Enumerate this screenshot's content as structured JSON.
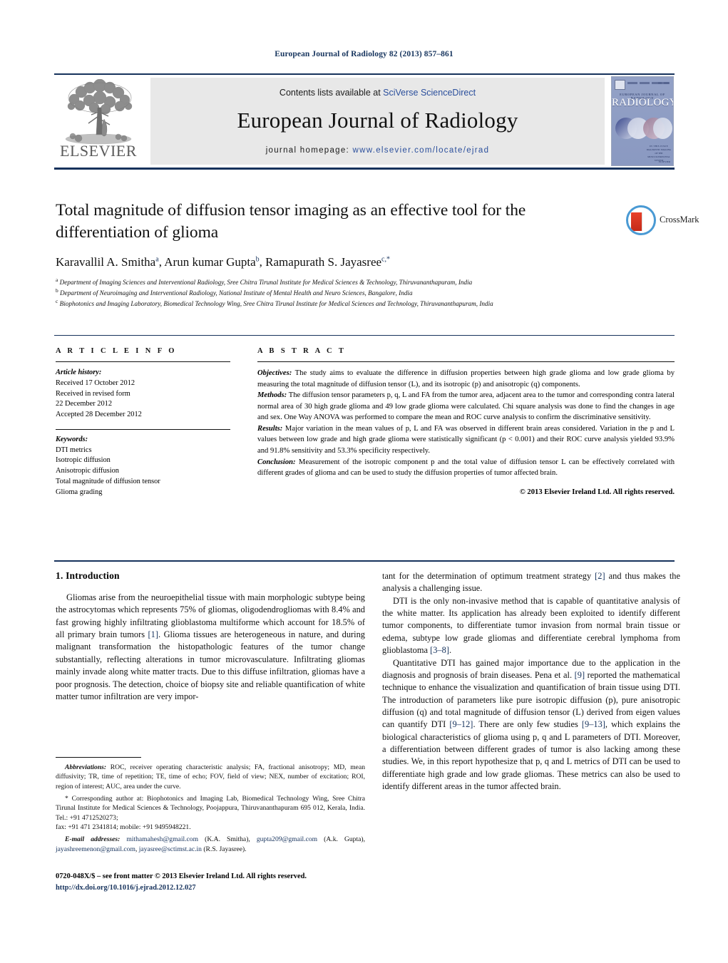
{
  "running_head": "European Journal of Radiology 82 (2013) 857–861",
  "masthead": {
    "publisher_name": "ELSEVIER",
    "contents_prefix": "Contents lists available at ",
    "contents_link": "SciVerse ScienceDirect",
    "journal_title": "European Journal of Radiology",
    "homepage_prefix": "journal homepage: ",
    "homepage_url": "www.elsevier.com/locate/ejrad"
  },
  "cover": {
    "journal_small": "EUROPEAN JOURNAL OF RADIOLOGY",
    "journal_big": "RADIOLOGY",
    "issue_heading": "IN THIS ISSUE",
    "issue_body": "DIAGNOSTIC IMAGING OF THE MUSCULOSKELETAL SYSTEM",
    "bottom_mark": "ELSEVIER"
  },
  "crossmark": {
    "label": "CrossMark"
  },
  "article": {
    "title": "Total magnitude of diffusion tensor imaging as an effective tool for the differentiation of glioma",
    "authors_html": "Karavallil A. Smitha<sup>a</sup>, Arun kumar Gupta<sup>b</sup>, Ramapurath S. Jayasree<sup>c,*</sup>",
    "affiliations": [
      "Department of Imaging Sciences and Interventional Radiology, Sree Chitra Tirunal Institute for Medical Sciences & Technology, Thiruvananthapuram, India",
      "Department of Neuroimaging and Interventional Radiology, National Institute of Mental Health and Neuro Sciences, Bangalore, India",
      "Biophotonics and Imaging Laboratory, Biomedical Technology Wing, Sree Chitra Tirunal Institute for Medical Sciences and Technology, Thiruvananthapuram, India"
    ]
  },
  "article_info": {
    "label": "A R T I C L E  I N F O",
    "history_label": "Article history:",
    "history_lines": [
      "Received 17 October 2012",
      "Received in revised form",
      "22 December 2012",
      "Accepted 28 December 2012"
    ],
    "keywords_label": "Keywords:",
    "keywords": [
      "DTI metrics",
      "Isotropic diffusion",
      "Anisotropic diffusion",
      "Total magnitude of diffusion tensor",
      "Glioma grading"
    ]
  },
  "abstract": {
    "label": "A B S T R A C T",
    "objectives_label": "Objectives:",
    "objectives_text": " The study aims to evaluate the difference in diffusion properties between high grade glioma and low grade glioma by measuring the total magnitude of diffusion tensor (L), and its isotropic (p) and anisotropic (q) components.",
    "methods_label": "Methods:",
    "methods_text": " The diffusion tensor parameters p, q, L and FA from the tumor area, adjacent area to the tumor and corresponding contra lateral normal area of 30 high grade glioma and 49 low grade glioma were calculated. Chi square analysis was done to find the changes in age and sex. One Way ANOVA was performed to compare the mean and ROC curve analysis to confirm the discriminative sensitivity.",
    "results_label": "Results:",
    "results_text": " Major variation in the mean values of p, L and FA was observed in different brain areas considered. Variation in the p and L values between low grade and high grade glioma were statistically significant (p < 0.001) and their ROC curve analysis yielded 93.9% and 91.8% sensitivity and 53.3% specificity respectively.",
    "conclusion_label": "Conclusion:",
    "conclusion_text": " Measurement of the isotropic component p and the total value of diffusion tensor L can be effectively correlated with different grades of glioma and can be used to study the diffusion properties of tumor affected brain.",
    "copyright": "© 2013 Elsevier Ireland Ltd. All rights reserved."
  },
  "introduction": {
    "heading": "1.  Introduction",
    "para1_a": "Gliomas arise from the neuroepithelial tissue with main morphologic subtype being the astrocytomas which represents 75% of gliomas, oligodendrogliomas with 8.4% and fast growing highly infiltrating glioblastoma multiforme which account for 18.5% of all primary brain tumors ",
    "para1_ref": "[1]",
    "para1_b": ". Glioma tissues are heterogeneous in nature, and during malignant transformation the histopathologic features of the tumor change substantially, reflecting alterations in tumor microvasculature. Infiltrating gliomas mainly invade along white matter tracts. Due to this diffuse infiltration, gliomas have a poor prognosis. The detection, choice of biopsy site and reliable quantification of white matter tumor infiltration are very important for the determination of optimum treatment strategy ",
    "para1_ref2": "[2]",
    "para1_c": " and thus makes the analysis a challenging issue.",
    "para2_a": "DTI is the only non-invasive method that is capable of quantitative analysis of the white matter. Its application has already been exploited to identify different tumor components, to differentiate tumor invasion from normal brain tissue or edema, subtype low grade gliomas and differentiate cerebral lymphoma from glioblastoma ",
    "para2_ref": "[3–8]",
    "para2_b": ".",
    "para3_a": "Quantitative DTI has gained major importance due to the application in the diagnosis and prognosis of brain diseases. Pena et al. ",
    "para3_ref": "[9]",
    "para3_b": " reported the mathematical technique to enhance the visualization and quantification of brain tissue using DTI. The introduction of parameters like pure isotropic diffusion (p), pure anisotropic diffusion (q) and total magnitude of diffusion tensor (L) derived from eigen values can quantify DTI ",
    "para3_ref2": "[9–12]",
    "para3_c": ". There are only few studies ",
    "para3_ref3": "[9–13]",
    "para3_d": ", which explains the biological characteristics of glioma using p, q and L parameters of DTI. Moreover, a differentiation between different grades of tumor is also lacking among these studies. We, in this report hypothesize that p, q and L metrics of DTI can be used to differentiate high grade and low grade gliomas. These metrics can also be used to identify different areas in the tumor affected brain."
  },
  "footnotes": {
    "abbreviations_label": "Abbreviations:",
    "abbreviations_text": "  ROC, receiver operating characteristic analysis; FA, fractional anisotropy; MD, mean diffusivity; TR, time of repetition; TE, time of echo; FOV, field of view; NEX, number of excitation; ROI, region of interest; AUC, area under the curve.",
    "corresponding_text": "* Corresponding author at: Biophotonics and Imaging Lab, Biomedical Technology Wing, Sree Chitra Tirunal Institute for Medical Sciences & Technology, Poojappura, Thiruvananthapuram 695 012, Kerala, India. Tel.: +91 4712520273;",
    "fax_line": "fax: +91 471 2341814; mobile: +91 9495948221.",
    "email_label": "E-mail addresses:",
    "email_1": "mithamahesh@gmail.com",
    "email_1_owner": " (K.A. Smitha), ",
    "email_2": "gupta209@gmail.com",
    "email_2_owner": " (A.k. Gupta), ",
    "email_3": "jayashreemenon@gmail.com",
    "email_sep": ", ",
    "email_4": "jayasree@sctimst.ac.in",
    "email_4_owner": " (R.S. Jayasree)."
  },
  "imprint": {
    "line1": "0720-048X/$ – see front matter © 2013 Elsevier Ireland Ltd. All rights reserved.",
    "doi": "http://dx.doi.org/10.1016/j.ejrad.2012.12.027"
  },
  "colors": {
    "rule_navy": "#16325c",
    "link_blue": "#2b4f9c",
    "banner_gray": "#e8e8e8",
    "elsevier_orange": "#f08a00",
    "crossmark_blue": "#4a9ad4",
    "crossmark_red": "#e8402a"
  }
}
